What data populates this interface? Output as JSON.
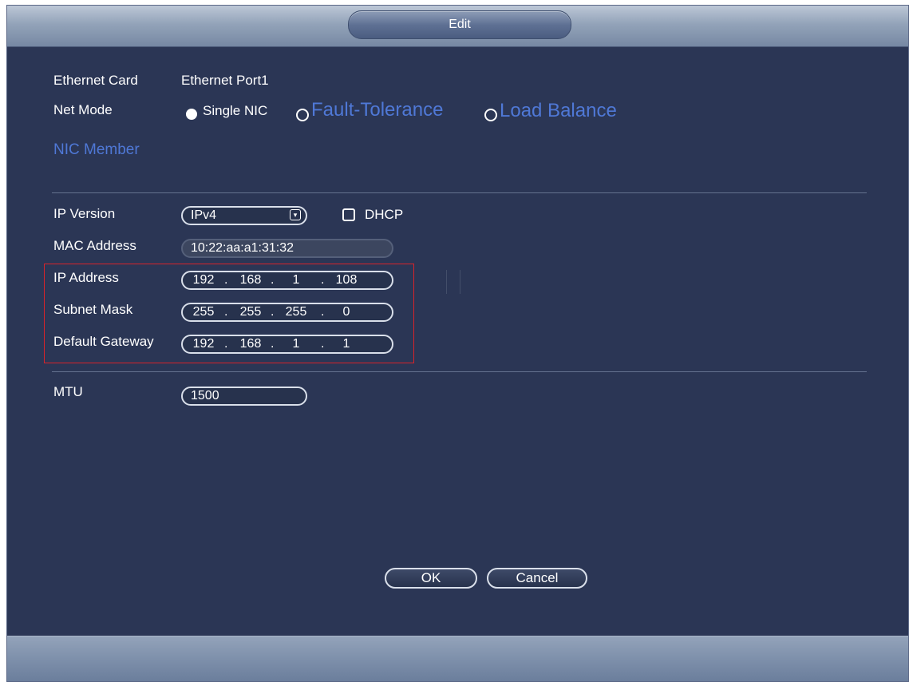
{
  "dialog": {
    "title": "Edit"
  },
  "ethernet_card": {
    "label": "Ethernet Card",
    "value": "Ethernet Port1"
  },
  "net_mode": {
    "label": "Net Mode",
    "options": [
      "Single NIC",
      "Fault-Tolerance",
      "Load Balance"
    ],
    "selected": "Single NIC"
  },
  "nic_member": {
    "label": "NIC Member"
  },
  "ip_version": {
    "label": "IP Version",
    "value": "IPv4"
  },
  "dhcp": {
    "label": "DHCP",
    "checked": false
  },
  "mac_address": {
    "label": "MAC Address",
    "value": "10:22:aa:a1:31:32"
  },
  "ip_address": {
    "label": "IP Address",
    "octets": [
      "192",
      "168",
      "1",
      "108"
    ]
  },
  "subnet_mask": {
    "label": "Subnet Mask",
    "octets": [
      "255",
      "255",
      "255",
      "0"
    ]
  },
  "default_gateway": {
    "label": "Default Gateway",
    "octets": [
      "192",
      "168",
      "1",
      "1"
    ]
  },
  "mtu": {
    "label": "MTU",
    "value": "1500"
  },
  "buttons": {
    "ok": "OK",
    "cancel": "Cancel"
  },
  "colors": {
    "panel": "#2b3655",
    "accent_blue_text": "#4f78d6",
    "highlight_border": "#d8232a",
    "titlebar": "#93a3b9"
  }
}
